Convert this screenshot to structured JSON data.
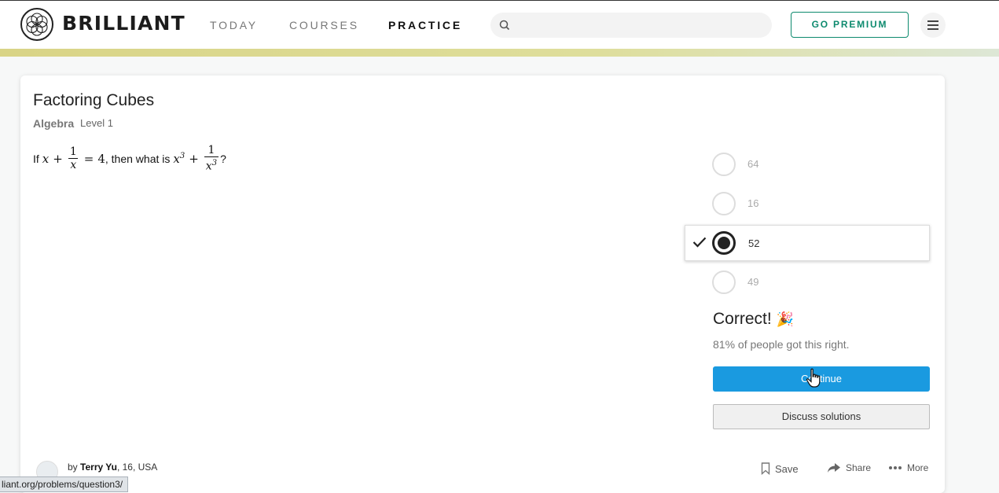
{
  "header": {
    "brand": "BRILLIANT",
    "nav": [
      "TODAY",
      "COURSES",
      "PRACTICE"
    ],
    "active_nav": "PRACTICE",
    "search_placeholder": "",
    "premium_label": "GO PREMIUM",
    "icons": [
      "brilliant-logo-icon",
      "search-icon",
      "hamburger-menu-icon"
    ]
  },
  "problem": {
    "title": "Factoring Cubes",
    "subject": "Algebra",
    "level": "Level 1",
    "question": {
      "prefix": "If",
      "var": "x",
      "plus": "+",
      "one": "1",
      "equals": "=",
      "value": "4",
      "middle": ", then what is",
      "exp": "3",
      "end": "?"
    }
  },
  "options": {
    "items": [
      "64",
      "16",
      "52",
      "49"
    ],
    "selected": "52"
  },
  "feedback": {
    "result": "Correct!",
    "emoji": "🎉",
    "stats": "81% of people got this right.",
    "continue_label": "Continue",
    "discuss_label": "Discuss solutions"
  },
  "author": {
    "by": "by",
    "name": "Terry Yu",
    "details": ", 16, USA"
  },
  "actions": {
    "save": "Save",
    "share": "Share",
    "more": "More"
  },
  "statusbar": {
    "url": "liant.org/problems/question3/"
  },
  "colors": {
    "accent_green": "#0d8a6e",
    "continue_blue": "#1a9ae0"
  }
}
